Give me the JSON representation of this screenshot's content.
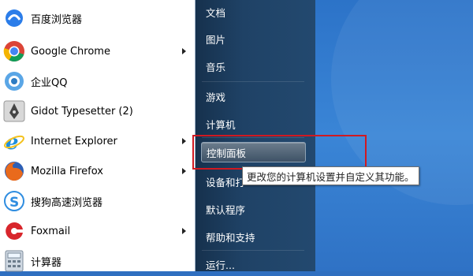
{
  "programs": [
    {
      "label": "百度浏览器",
      "icon": "baidu-browser-icon",
      "has_submenu": false
    },
    {
      "label": "Google Chrome",
      "icon": "chrome-icon",
      "has_submenu": true
    },
    {
      "label": "企业QQ",
      "icon": "qq-icon",
      "has_submenu": false
    },
    {
      "label": "Gidot Typesetter (2)",
      "icon": "gidot-pen-icon",
      "has_submenu": false
    },
    {
      "label": "Internet Explorer",
      "icon": "internet-explorer-icon",
      "has_submenu": true
    },
    {
      "label": "Mozilla Firefox",
      "icon": "firefox-icon",
      "has_submenu": true
    },
    {
      "label": "搜狗高速浏览器",
      "icon": "sogou-browser-icon",
      "has_submenu": false
    },
    {
      "label": "Foxmail",
      "icon": "foxmail-icon",
      "has_submenu": true
    },
    {
      "label": "计算器",
      "icon": "calculator-icon",
      "has_submenu": false
    }
  ],
  "right_items": [
    {
      "label": "文档"
    },
    {
      "label": "图片"
    },
    {
      "label": "音乐"
    },
    {
      "label": "游戏"
    },
    {
      "label": "计算机"
    },
    {
      "label": "控制面板",
      "highlighted": true
    },
    {
      "label": "设备和打"
    },
    {
      "label": "默认程序"
    },
    {
      "label": "帮助和支持"
    },
    {
      "label": "运行..."
    }
  ],
  "tooltip": "更改您的计算机设置并自定义其功能。",
  "colors": {
    "highlight_border": "#d01921",
    "right_pane": "#1f4266",
    "desktop": "#3a85d6"
  }
}
